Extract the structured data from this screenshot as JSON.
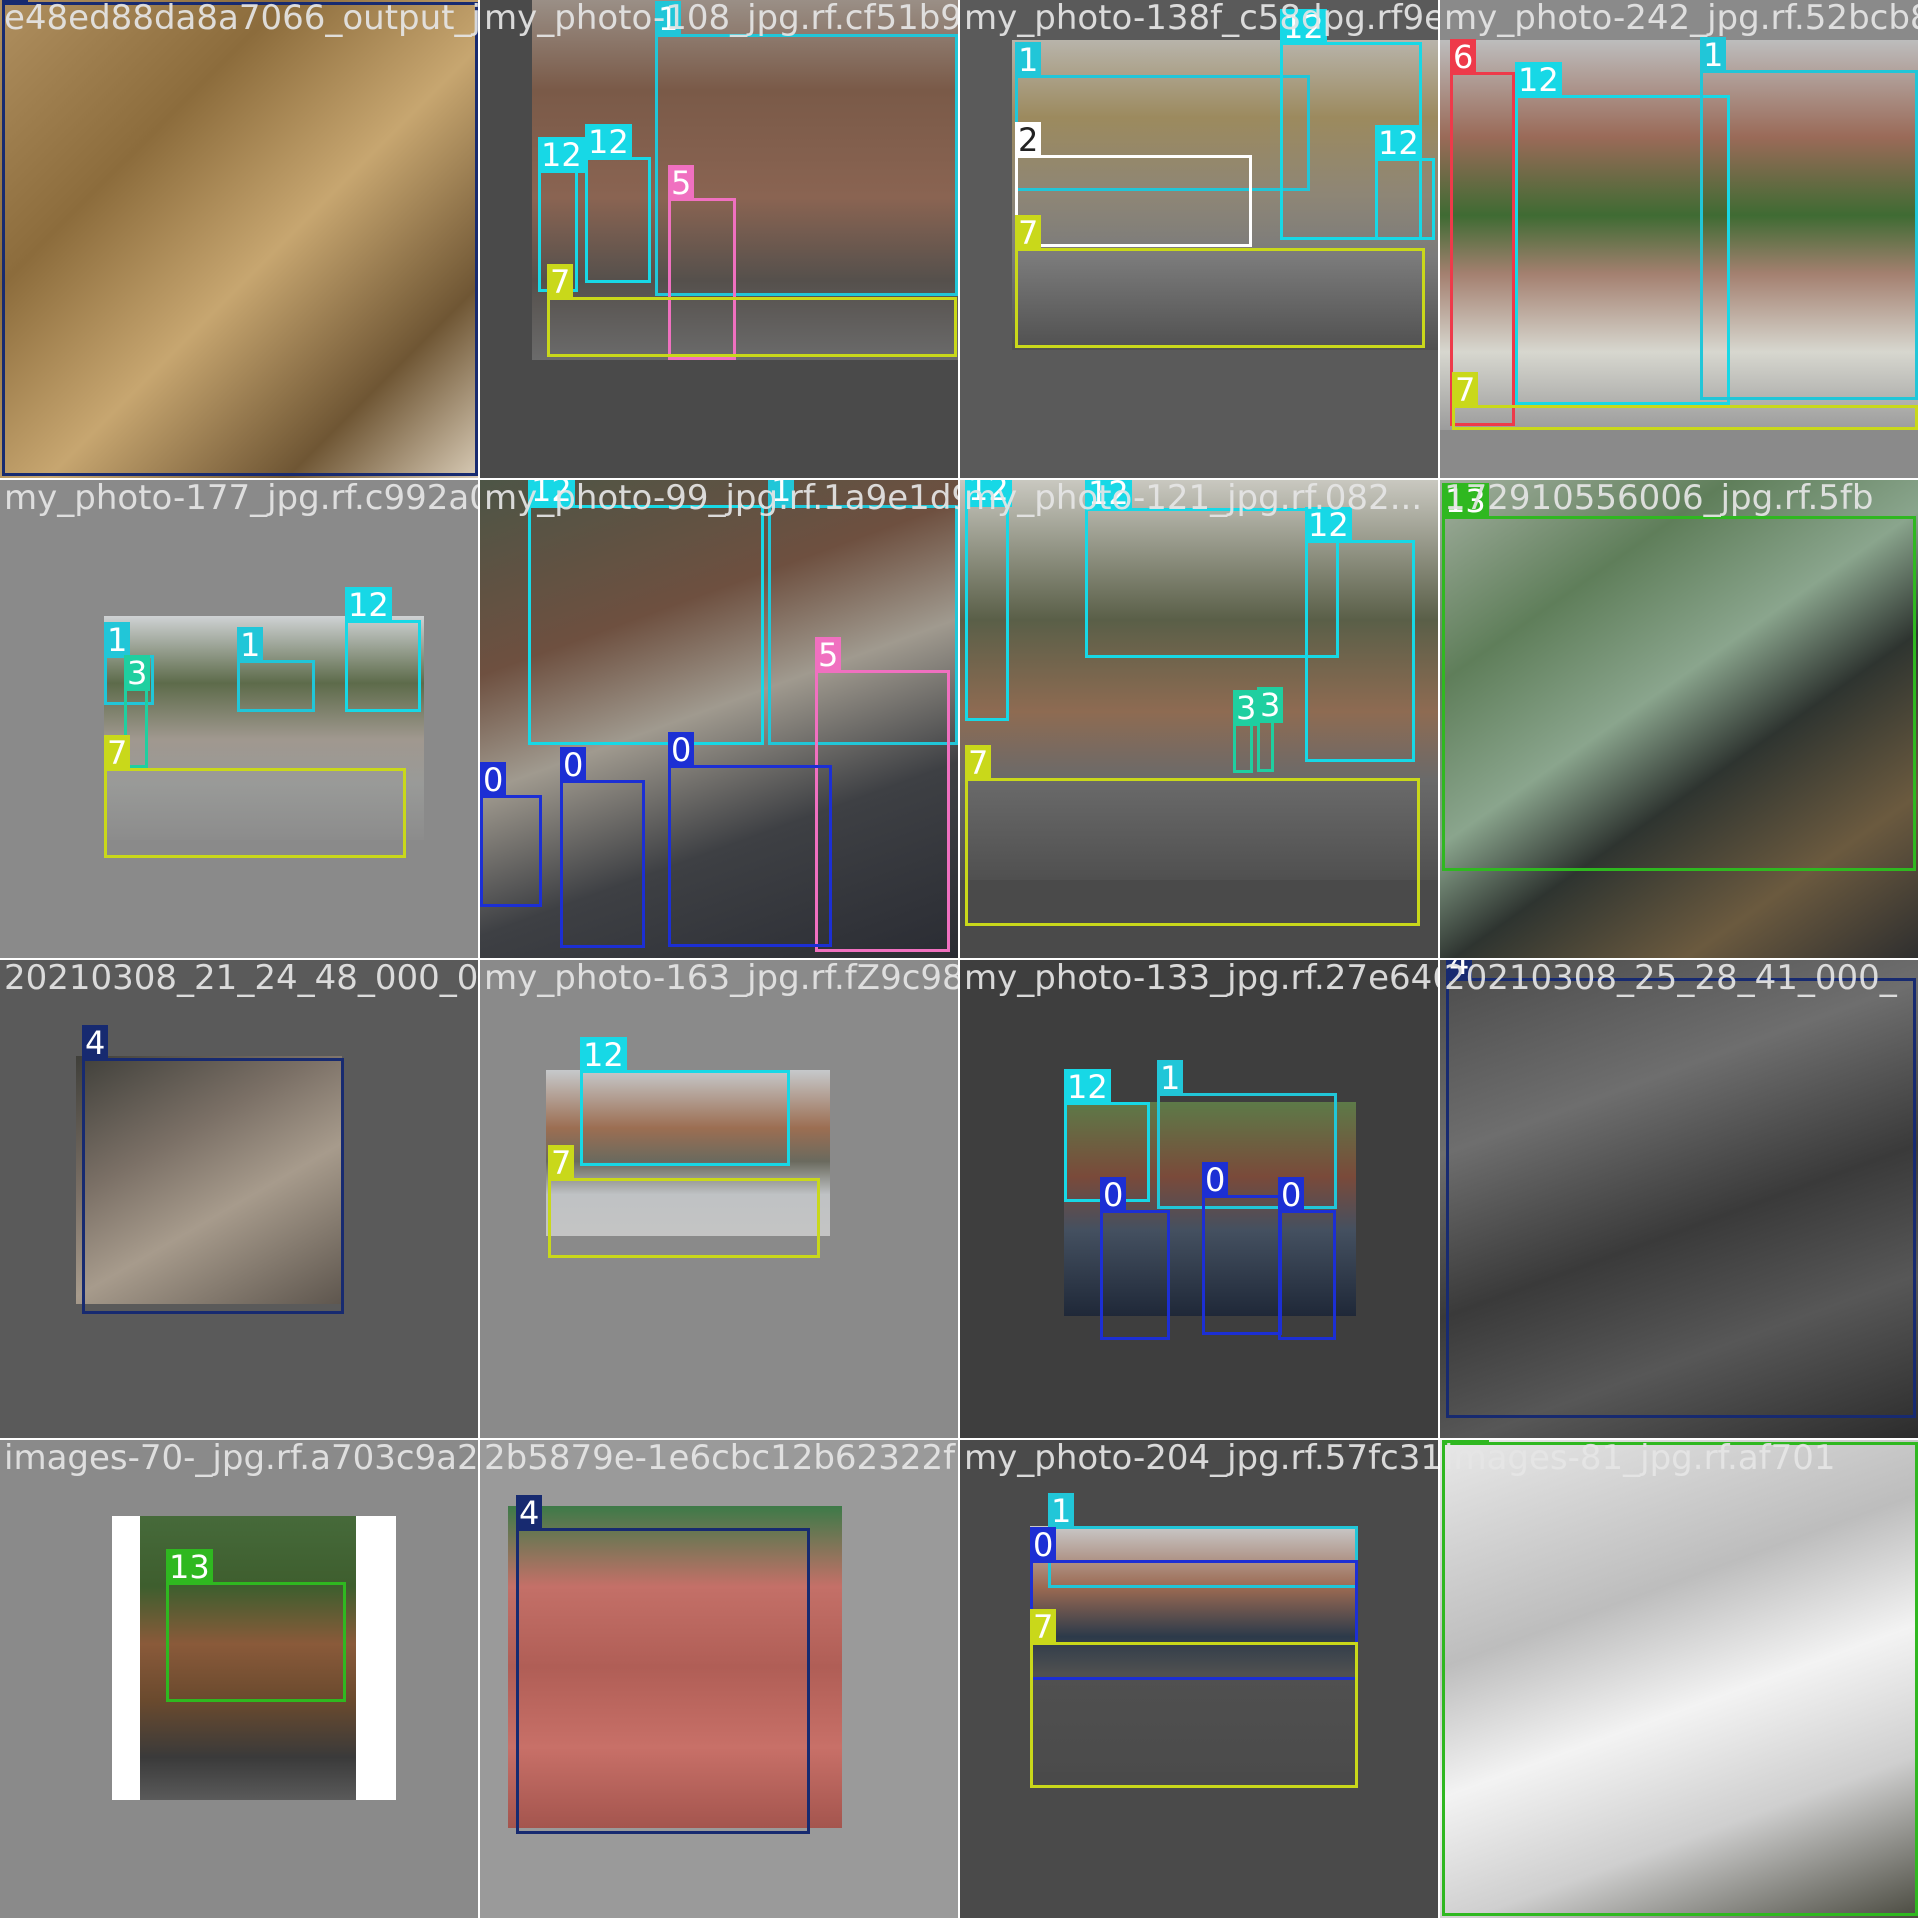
{
  "colors": {
    "0": "#1c2fd4",
    "1": "#21c6d8",
    "2": "#ffffff",
    "3": "#1fcfa0",
    "4": "#172a70",
    "5": "#f070c0",
    "6": "#ee3a4a",
    "7": "#c9d81a",
    "12": "#17d8e6",
    "13": "#2fb820"
  },
  "tiles": [
    {
      "file": "e48ed88da8a7066_output_jpg.rf.41b09...",
      "scene": "indoor-staircase",
      "boxes": [
        {
          "cls": "4"
        }
      ]
    },
    {
      "file": "my_photo-108_jpg.rf.cf51b944a64c1...",
      "scene": "brick-building-with-sign",
      "boxes": [
        {
          "cls": "1"
        },
        {
          "cls": "12"
        },
        {
          "cls": "12"
        },
        {
          "cls": "5"
        },
        {
          "cls": "7"
        }
      ]
    },
    {
      "file": "my_photo-138f_c58dpg.rf9e65c70...",
      "scene": "parked-car-building",
      "boxes": [
        {
          "cls": "1"
        },
        {
          "cls": "12"
        },
        {
          "cls": "12"
        },
        {
          "cls": "2"
        },
        {
          "cls": "7"
        }
      ]
    },
    {
      "file": "my_photo-242_jpg.rf.52bcb87",
      "scene": "tree-and-pole",
      "boxes": [
        {
          "cls": "6"
        },
        {
          "cls": "12"
        },
        {
          "cls": "1"
        },
        {
          "cls": "7"
        }
      ]
    },
    {
      "file": "my_photo-177_jpg.rf.c992a0c...",
      "scene": "campus-road",
      "boxes": [
        {
          "cls": "1"
        },
        {
          "cls": "1"
        },
        {
          "cls": "12"
        },
        {
          "cls": "3"
        },
        {
          "cls": "7"
        }
      ]
    },
    {
      "file": "my_photo-99_jpg.rf.1a9e1d9...",
      "scene": "scooters-building",
      "boxes": [
        {
          "cls": "12"
        },
        {
          "cls": "1"
        },
        {
          "cls": "5"
        },
        {
          "cls": "0"
        },
        {
          "cls": "0"
        },
        {
          "cls": "0"
        }
      ]
    },
    {
      "file": "my_photo-121_jpg.rf.082...",
      "scene": "trees-wall-road",
      "boxes": [
        {
          "cls": "12"
        },
        {
          "cls": "12"
        },
        {
          "cls": "12"
        },
        {
          "cls": "3"
        },
        {
          "cls": "3"
        },
        {
          "cls": "7"
        }
      ]
    },
    {
      "file": "172910556006_jpg.rf.5fb",
      "scene": "guardrail",
      "boxes": [
        {
          "cls": "13"
        }
      ]
    },
    {
      "file": "20210308_21_24_48_000_03EWZf90",
      "scene": "dark-staircase",
      "boxes": [
        {
          "cls": "4"
        }
      ]
    },
    {
      "file": "my_photo-163_jpg.rf.fZ9c98",
      "scene": "small-building",
      "boxes": [
        {
          "cls": "12"
        },
        {
          "cls": "7"
        }
      ]
    },
    {
      "file": "my_photo-133_jpg.rf.27e646c",
      "scene": "motorbikes-building",
      "boxes": [
        {
          "cls": "12"
        },
        {
          "cls": "1"
        },
        {
          "cls": "0"
        },
        {
          "cls": "0"
        },
        {
          "cls": "0"
        }
      ]
    },
    {
      "file": "20210308_25_28_41_000_",
      "scene": "floor-with-cloth",
      "boxes": [
        {
          "cls": "4"
        }
      ]
    },
    {
      "file": "images-70-_jpg.rf.a703c9a2e",
      "scene": "guardrail-curve",
      "boxes": [
        {
          "cls": "13"
        }
      ]
    },
    {
      "file": "2b5879e-1e6cbc12b62322fb",
      "scene": "red-stairs",
      "boxes": [
        {
          "cls": "4"
        }
      ]
    },
    {
      "file": "my_photo-204_jpg.rf.57fc31",
      "scene": "motorbike-row",
      "boxes": [
        {
          "cls": "1"
        },
        {
          "cls": "0"
        },
        {
          "cls": "7"
        }
      ]
    },
    {
      "file": "images-81_jpg.rf.af701",
      "scene": "white-guardrail",
      "boxes": [
        {
          "cls": "13"
        }
      ]
    }
  ]
}
